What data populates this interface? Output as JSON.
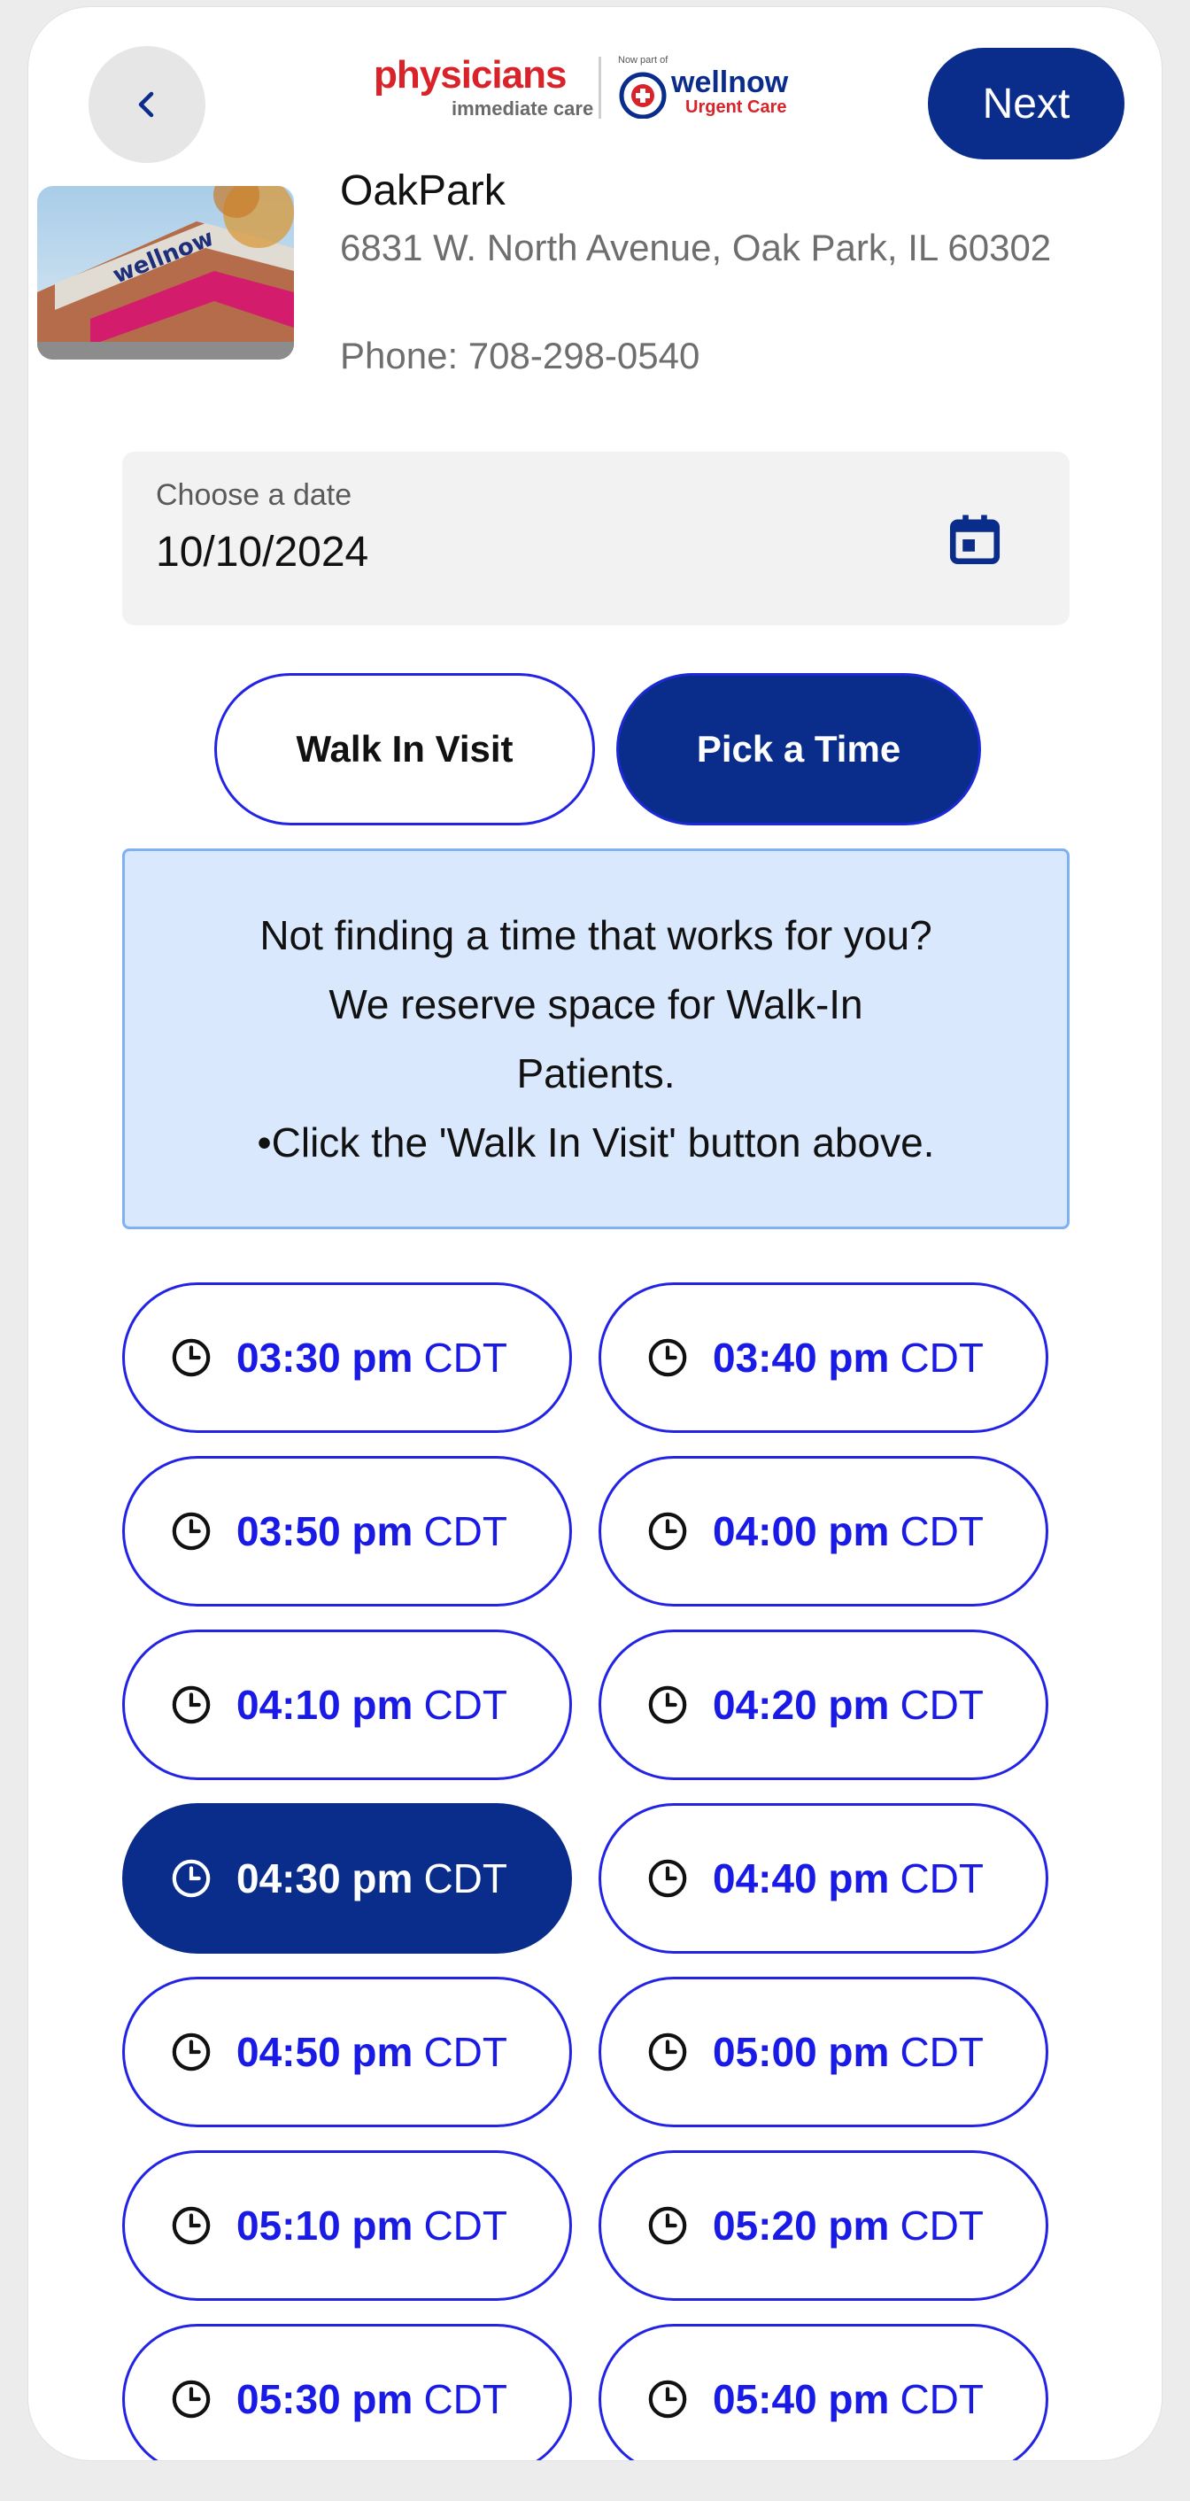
{
  "header": {
    "next_label": "Next",
    "logo": {
      "brand": "physicians",
      "tagline": "immediate care",
      "now_part_of": "Now part of",
      "partner": "wellnow",
      "partner_sub": "Urgent Care"
    }
  },
  "location": {
    "name": "OakPark",
    "address": "6831 W. North Avenue, Oak Park, IL 60302",
    "phone": "Phone: 708-298-0540"
  },
  "date_field": {
    "label": "Choose a date",
    "value": "10/10/2024"
  },
  "visit_type": {
    "walk_in_label": "Walk In Visit",
    "pick_time_label": "Pick a Time",
    "selected": "Pick a Time"
  },
  "info_message": {
    "line1": "Not finding a time that works for you?",
    "line2": "We reserve space for Walk-In",
    "line3": "Patients.",
    "line4": "•Click the 'Walk In Visit' button above."
  },
  "time_slots": [
    {
      "time": "03:30 pm",
      "tz": "CDT"
    },
    {
      "time": "03:40 pm",
      "tz": "CDT"
    },
    {
      "time": "03:50 pm",
      "tz": "CDT"
    },
    {
      "time": "04:00 pm",
      "tz": "CDT"
    },
    {
      "time": "04:10 pm",
      "tz": "CDT"
    },
    {
      "time": "04:20 pm",
      "tz": "CDT"
    },
    {
      "time": "04:30 pm",
      "tz": "CDT",
      "selected": true
    },
    {
      "time": "04:40 pm",
      "tz": "CDT"
    },
    {
      "time": "04:50 pm",
      "tz": "CDT"
    },
    {
      "time": "05:00 pm",
      "tz": "CDT"
    },
    {
      "time": "05:10 pm",
      "tz": "CDT"
    },
    {
      "time": "05:20 pm",
      "tz": "CDT"
    },
    {
      "time": "05:30 pm",
      "tz": "CDT"
    },
    {
      "time": "05:40 pm",
      "tz": "CDT"
    }
  ],
  "colors": {
    "primary": "#0a2d8c",
    "accent_blue": "#2323e6",
    "brand_red": "#d8232a",
    "info_bg": "#d9e8fc"
  },
  "icons": [
    "chevron-left-icon",
    "calendar-icon",
    "clock-icon"
  ]
}
